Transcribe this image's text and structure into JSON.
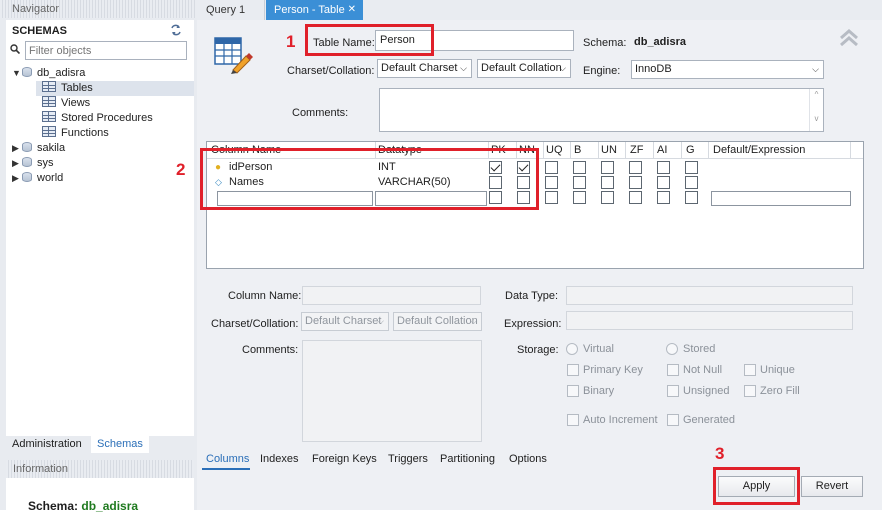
{
  "navigator": {
    "title": "Navigator",
    "schemas_title": "SCHEMAS",
    "filter_placeholder": "Filter objects",
    "tree": {
      "db_adisra": "db_adisra",
      "tables": "Tables",
      "views": "Views",
      "stored_procedures": "Stored Procedures",
      "functions": "Functions",
      "sakila": "sakila",
      "sys": "sys",
      "world": "world"
    },
    "tabs": {
      "administration": "Administration",
      "schemas": "Schemas"
    },
    "information_title": "Information",
    "info_schema_label": "Schema:",
    "info_schema_value": "db_adisra"
  },
  "tabs": {
    "query": "Query 1",
    "person_table": "Person - Table",
    "close_symbol": "✕"
  },
  "editor": {
    "table_name_label": "Table Name:",
    "table_name_value": "Person",
    "schema_label": "Schema:",
    "schema_value": "db_adisra",
    "charset_label": "Charset/Collation:",
    "charset_value": "Default Charset",
    "collation_value": "Default Collation",
    "engine_label": "Engine:",
    "engine_value": "InnoDB",
    "comments_label": "Comments:"
  },
  "grid": {
    "headers": [
      "Column Name",
      "Datatype",
      "PK",
      "NN",
      "UQ",
      "B",
      "UN",
      "ZF",
      "AI",
      "G",
      "Default/Expression"
    ],
    "rows": [
      {
        "name": "idPerson",
        "datatype": "INT",
        "pk": true,
        "nn": true,
        "uq": false,
        "b": false,
        "un": false,
        "zf": false,
        "ai": false,
        "g": false,
        "icon": "primary-key-icon"
      },
      {
        "name": "Names",
        "datatype": "VARCHAR(50)",
        "pk": false,
        "nn": false,
        "uq": false,
        "b": false,
        "un": false,
        "zf": false,
        "ai": false,
        "g": false,
        "icon": "column-diamond-icon"
      }
    ]
  },
  "details": {
    "column_name_label": "Column Name:",
    "data_type_label": "Data Type:",
    "charset_label": "Charset/Collation:",
    "charset_value": "Default Charset",
    "collation_value": "Default Collation",
    "expression_label": "Expression:",
    "comments_label": "Comments:",
    "storage_label": "Storage:",
    "virtual": "Virtual",
    "stored": "Stored",
    "primary_key": "Primary Key",
    "not_null": "Not Null",
    "unique": "Unique",
    "binary": "Binary",
    "unsigned": "Unsigned",
    "zero_fill": "Zero Fill",
    "auto_increment": "Auto Increment",
    "generated": "Generated"
  },
  "bottom_tabs": [
    "Columns",
    "Indexes",
    "Foreign Keys",
    "Triggers",
    "Partitioning",
    "Options"
  ],
  "buttons": {
    "apply": "Apply",
    "revert": "Revert"
  },
  "annotations": {
    "one": "1",
    "two": "2",
    "three": "3",
    "color": "#e0202a"
  },
  "colors": {
    "accent_tab": "#3b8fd6",
    "link_blue": "#2b6fb8",
    "schema_green": "#1f7a1f"
  }
}
